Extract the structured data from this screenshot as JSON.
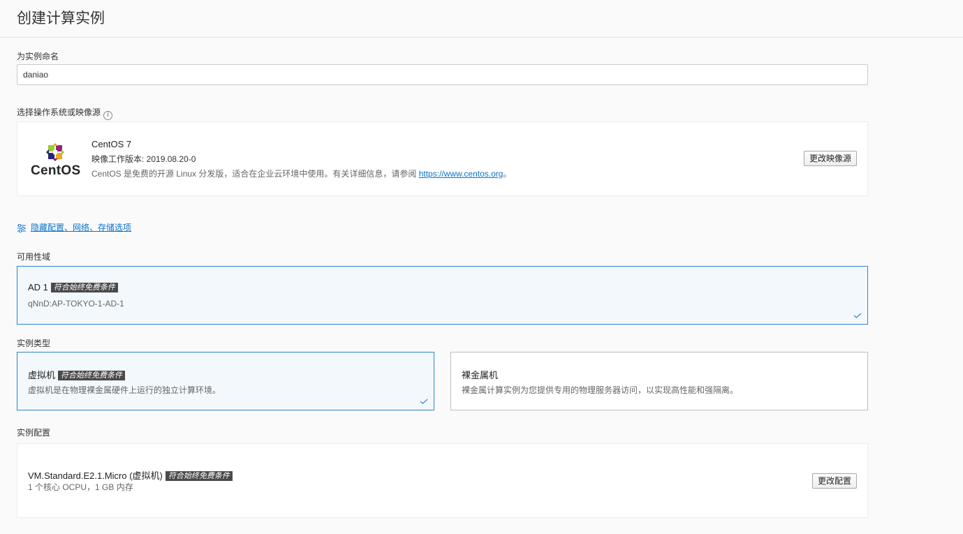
{
  "page": {
    "title": "创建计算实例"
  },
  "name_field": {
    "label": "为实例命名",
    "value": "daniao"
  },
  "image_section": {
    "label": "选择操作系统或映像源",
    "logo_text": "CentOS",
    "name": "CentOS 7",
    "version": "映像工作版本: 2019.08.20-0",
    "desc_prefix": "CentOS 是免费的开源 Linux 分发版，适合在企业云环境中使用。有关详细信息，请参阅 ",
    "desc_link": "https://www.centos.org",
    "desc_suffix": "。",
    "change_button": "更改映像源"
  },
  "advanced_link": {
    "label": "隐藏配置、网络、存储选项",
    "icon": "sliders-icon"
  },
  "availability_domain": {
    "label": "可用性域",
    "options": [
      {
        "title": "AD 1",
        "badge": "符合始终免费条件",
        "subtitle": "qNnD:AP-TOKYO-1-AD-1",
        "selected": true
      }
    ]
  },
  "instance_type": {
    "label": "实例类型",
    "options": [
      {
        "title": "虚拟机",
        "badge": "符合始终免费条件",
        "subtitle": "虚拟机是在物理裸金属硬件上运行的独立计算环境。",
        "selected": true
      },
      {
        "title": "裸金属机",
        "subtitle": "裸金属计算实例为您提供专用的物理服务器访问，以实现高性能和强隔离。",
        "selected": false
      }
    ]
  },
  "shape": {
    "label": "实例配置",
    "name": "VM.Standard.E2.1.Micro (虚拟机)",
    "badge": "符合始终免费条件",
    "detail": "1 个核心 OCPU，1 GB 内存",
    "change_button": "更改配置"
  },
  "colors": {
    "accent": "#2c87c8",
    "link": "#0b73c9",
    "badge_bg": "#4a4a4a",
    "selected_bg": "#f3f8fc"
  }
}
